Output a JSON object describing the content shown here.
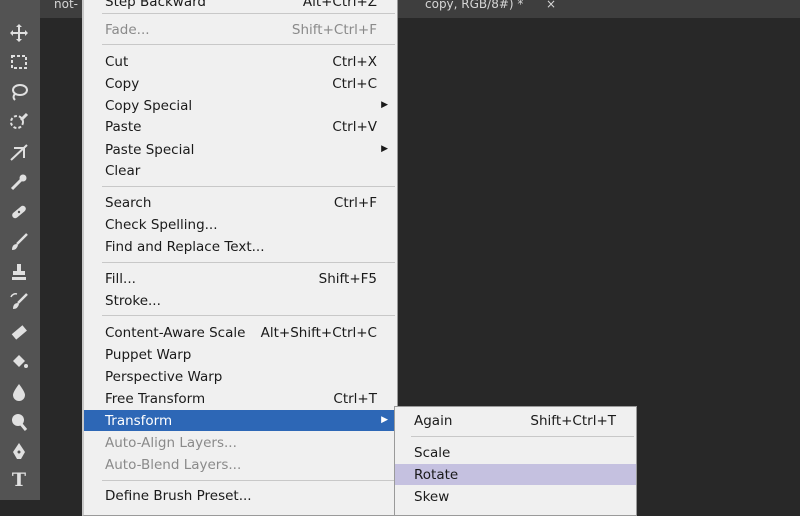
{
  "document_tabs": {
    "left_fragment": "not-",
    "right_fragment": "copy, RGB/8#) *",
    "close": "×"
  },
  "edit_menu": {
    "step_backward": {
      "label": "Step Backward",
      "shortcut": "Alt+Ctrl+Z"
    },
    "fade": {
      "label": "Fade...",
      "shortcut": "Shift+Ctrl+F"
    },
    "cut": {
      "label": "Cut",
      "shortcut": "Ctrl+X"
    },
    "copy": {
      "label": "Copy",
      "shortcut": "Ctrl+C"
    },
    "copy_special": {
      "label": "Copy Special"
    },
    "paste": {
      "label": "Paste",
      "shortcut": "Ctrl+V"
    },
    "paste_special": {
      "label": "Paste Special"
    },
    "clear": {
      "label": "Clear"
    },
    "search": {
      "label": "Search",
      "shortcut": "Ctrl+F"
    },
    "check_spelling": {
      "label": "Check Spelling..."
    },
    "find_replace": {
      "label": "Find and Replace Text..."
    },
    "fill": {
      "label": "Fill...",
      "shortcut": "Shift+F5"
    },
    "stroke": {
      "label": "Stroke..."
    },
    "content_aware_scale": {
      "label": "Content-Aware Scale",
      "shortcut": "Alt+Shift+Ctrl+C"
    },
    "puppet_warp": {
      "label": "Puppet Warp"
    },
    "perspective_warp": {
      "label": "Perspective Warp"
    },
    "free_transform": {
      "label": "Free Transform",
      "shortcut": "Ctrl+T"
    },
    "transform": {
      "label": "Transform"
    },
    "auto_align": {
      "label": "Auto-Align Layers..."
    },
    "auto_blend": {
      "label": "Auto-Blend Layers..."
    },
    "define_brush": {
      "label": "Define Brush Preset..."
    }
  },
  "transform_submenu": {
    "again": {
      "label": "Again",
      "shortcut": "Shift+Ctrl+T"
    },
    "scale": {
      "label": "Scale"
    },
    "rotate": {
      "label": "Rotate"
    },
    "skew": {
      "label": "Skew"
    }
  },
  "toolbar": {
    "type_tool_glyph": "T"
  },
  "colors": {
    "menu_bg": "#f0f0f0",
    "highlight": "#2d67b6",
    "submenu_hover": "#c5c1e0",
    "toolbar_bg": "#535353",
    "canvas_bg": "#282828"
  }
}
